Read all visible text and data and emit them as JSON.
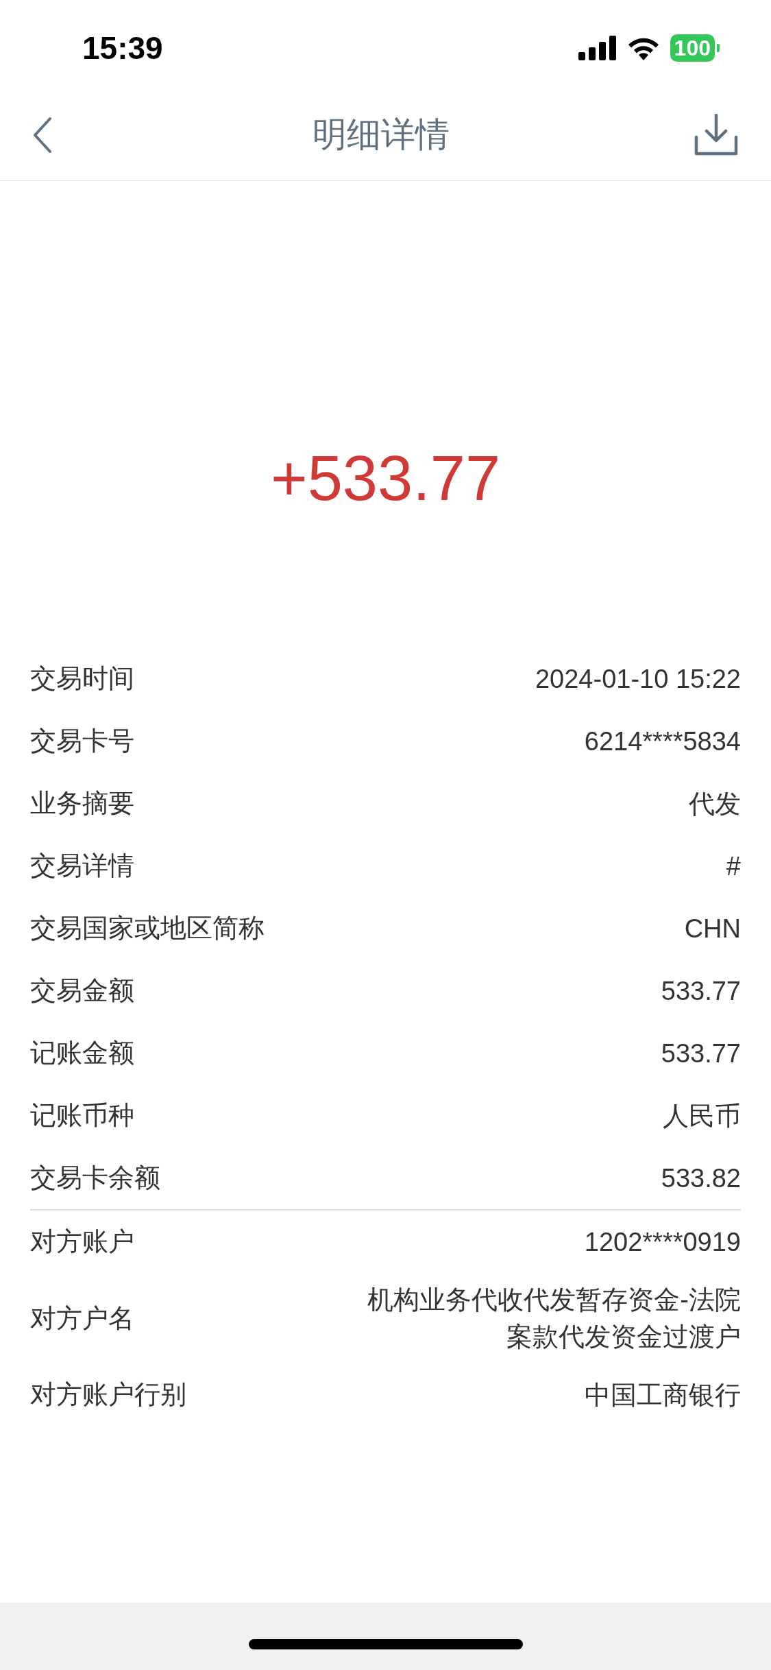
{
  "status_bar": {
    "time": "15:39",
    "battery": "100"
  },
  "nav": {
    "title": "明细详情"
  },
  "amount": "+533.77",
  "groups": [
    {
      "rows": [
        {
          "label": "交易时间",
          "value_lines": [
            "2024-01-10 15:22"
          ]
        },
        {
          "label": "交易卡号",
          "value_lines": [
            "6214****5834"
          ]
        },
        {
          "label": "业务摘要",
          "value_lines": [
            "代发"
          ]
        },
        {
          "label": "交易详情",
          "value_lines": [
            "#"
          ]
        },
        {
          "label": "交易国家或地区简称",
          "value_lines": [
            "CHN"
          ]
        },
        {
          "label": "交易金额",
          "value_lines": [
            "533.77"
          ]
        },
        {
          "label": "记账金额",
          "value_lines": [
            "533.77"
          ]
        },
        {
          "label": "记账币种",
          "value_lines": [
            "人民币"
          ]
        },
        {
          "label": "交易卡余额",
          "value_lines": [
            "533.82"
          ]
        }
      ]
    },
    {
      "rows": [
        {
          "label": "对方账户",
          "value_lines": [
            "1202****0919"
          ]
        },
        {
          "label": "对方户名",
          "value_lines": [
            "机构业务代收代发暂存资金-法院",
            "案款代发资金过渡户"
          ]
        },
        {
          "label": "对方账户行别",
          "value_lines": [
            "中国工商银行"
          ]
        }
      ]
    }
  ]
}
